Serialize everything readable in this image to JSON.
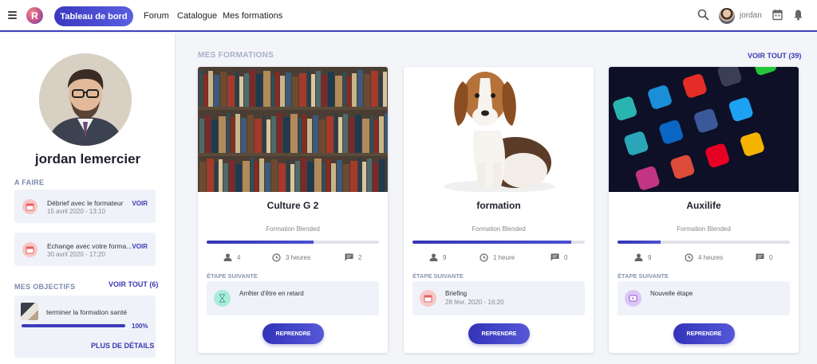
{
  "topbar": {
    "logo_letter": "R",
    "dashboard_label": "Tableau de bord",
    "nav": [
      "Forum",
      "Catalogue",
      "Mes formations"
    ],
    "user_name": "jordan",
    "icons": [
      "hamburger-icon",
      "search-icon",
      "calendar-icon",
      "bell-icon"
    ]
  },
  "sidebar": {
    "profile_name": "jordan lemercier",
    "todo_title": "A FAIRE",
    "todos": [
      {
        "title": "Débrief avec le formateur",
        "date": "15 avril 2020 - 13:10",
        "action": "VOIR"
      },
      {
        "title": "Echange avec votre forma...",
        "date": "30 avril 2020 - 17:20",
        "action": "VOIR"
      }
    ],
    "objectives_title": "MES OBJECTIFS",
    "objectives_voir": "VOIR TOUT (6)",
    "objective": {
      "label": "terminer la formation santé",
      "progress_pct": 100,
      "progress_text": "100%",
      "more": "PLUS DE DÉTAILS"
    }
  },
  "main": {
    "title": "MES FORMATIONS",
    "voir_tout": "VOIR TOUT (39)",
    "next_step_label": "ÉTAPE SUIVANTE",
    "resume_label": "REPRENDRE",
    "cards": [
      {
        "title": "Culture G 2",
        "type": "Formation Blended",
        "progress_pct": 62,
        "learners": "4",
        "duration": "3 heures",
        "comments": "2",
        "step_title": "Arrêter d'être en retard",
        "step_date": "",
        "step_icon": "hourglass-icon",
        "step_color": "#a9ecd8"
      },
      {
        "title": "formation",
        "type": "Formation Blended",
        "progress_pct": 92,
        "learners": "9",
        "duration": "1 heure",
        "comments": "0",
        "step_title": "Briefing",
        "step_date": "28 févr. 2020 - 16:20",
        "step_icon": "calendar-icon",
        "step_color": "#f7c7c7"
      },
      {
        "title": "Auxilife",
        "type": "Formation Blended",
        "progress_pct": 25,
        "learners": "9",
        "duration": "4 heures",
        "comments": "0",
        "step_title": "Nouvelle étape",
        "step_date": "",
        "step_icon": "video-icon",
        "step_color": "#dcc6f5"
      }
    ]
  }
}
